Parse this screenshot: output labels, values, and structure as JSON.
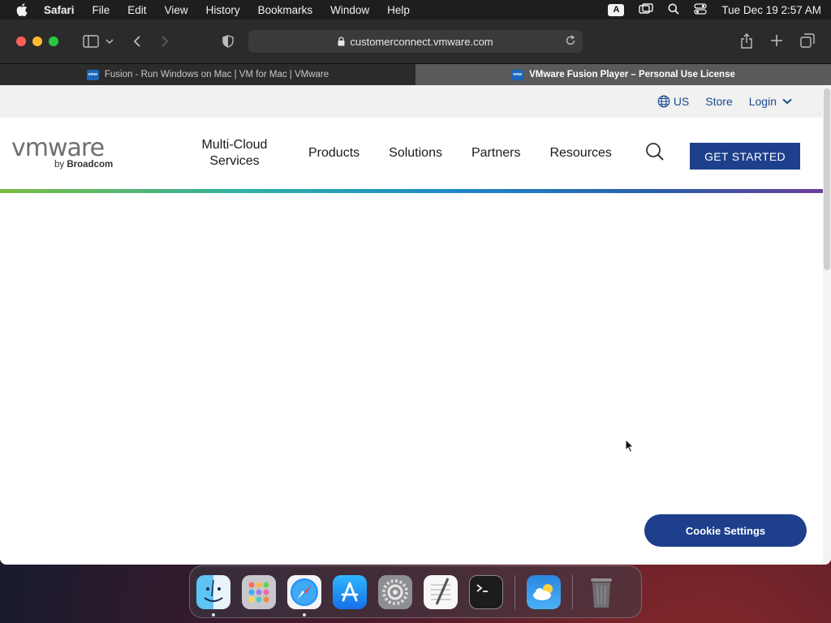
{
  "menubar": {
    "app_name": "Safari",
    "items": [
      "File",
      "Edit",
      "View",
      "History",
      "Bookmarks",
      "Window",
      "Help"
    ],
    "input_badge": "A",
    "datetime": "Tue Dec 19  2:57 AM"
  },
  "browser": {
    "url": "customerconnect.vmware.com",
    "tabs": [
      {
        "title": "Fusion - Run Windows on Mac | VM for Mac | VMware",
        "active": false
      },
      {
        "title": "VMware Fusion Player – Personal Use License",
        "active": true
      }
    ],
    "favicon_text": "vmw"
  },
  "utility_bar": {
    "region": "US",
    "store": "Store",
    "login": "Login"
  },
  "logo": {
    "brand": "vmware",
    "by": "by",
    "parent": "Broadcom"
  },
  "nav": {
    "multi_cloud_line1": "Multi-Cloud",
    "multi_cloud_line2": "Services",
    "products": "Products",
    "solutions": "Solutions",
    "partners": "Partners",
    "resources": "Resources",
    "cta": "GET STARTED"
  },
  "cookie_button": "Cookie Settings",
  "colors": {
    "primary_blue": "#1d3f8c",
    "link_blue": "#1b4a8c"
  },
  "dock": [
    "Finder",
    "Launchpad",
    "Safari",
    "App Store",
    "System Preferences",
    "TextEdit",
    "Terminal",
    "Weather",
    "Trash"
  ]
}
